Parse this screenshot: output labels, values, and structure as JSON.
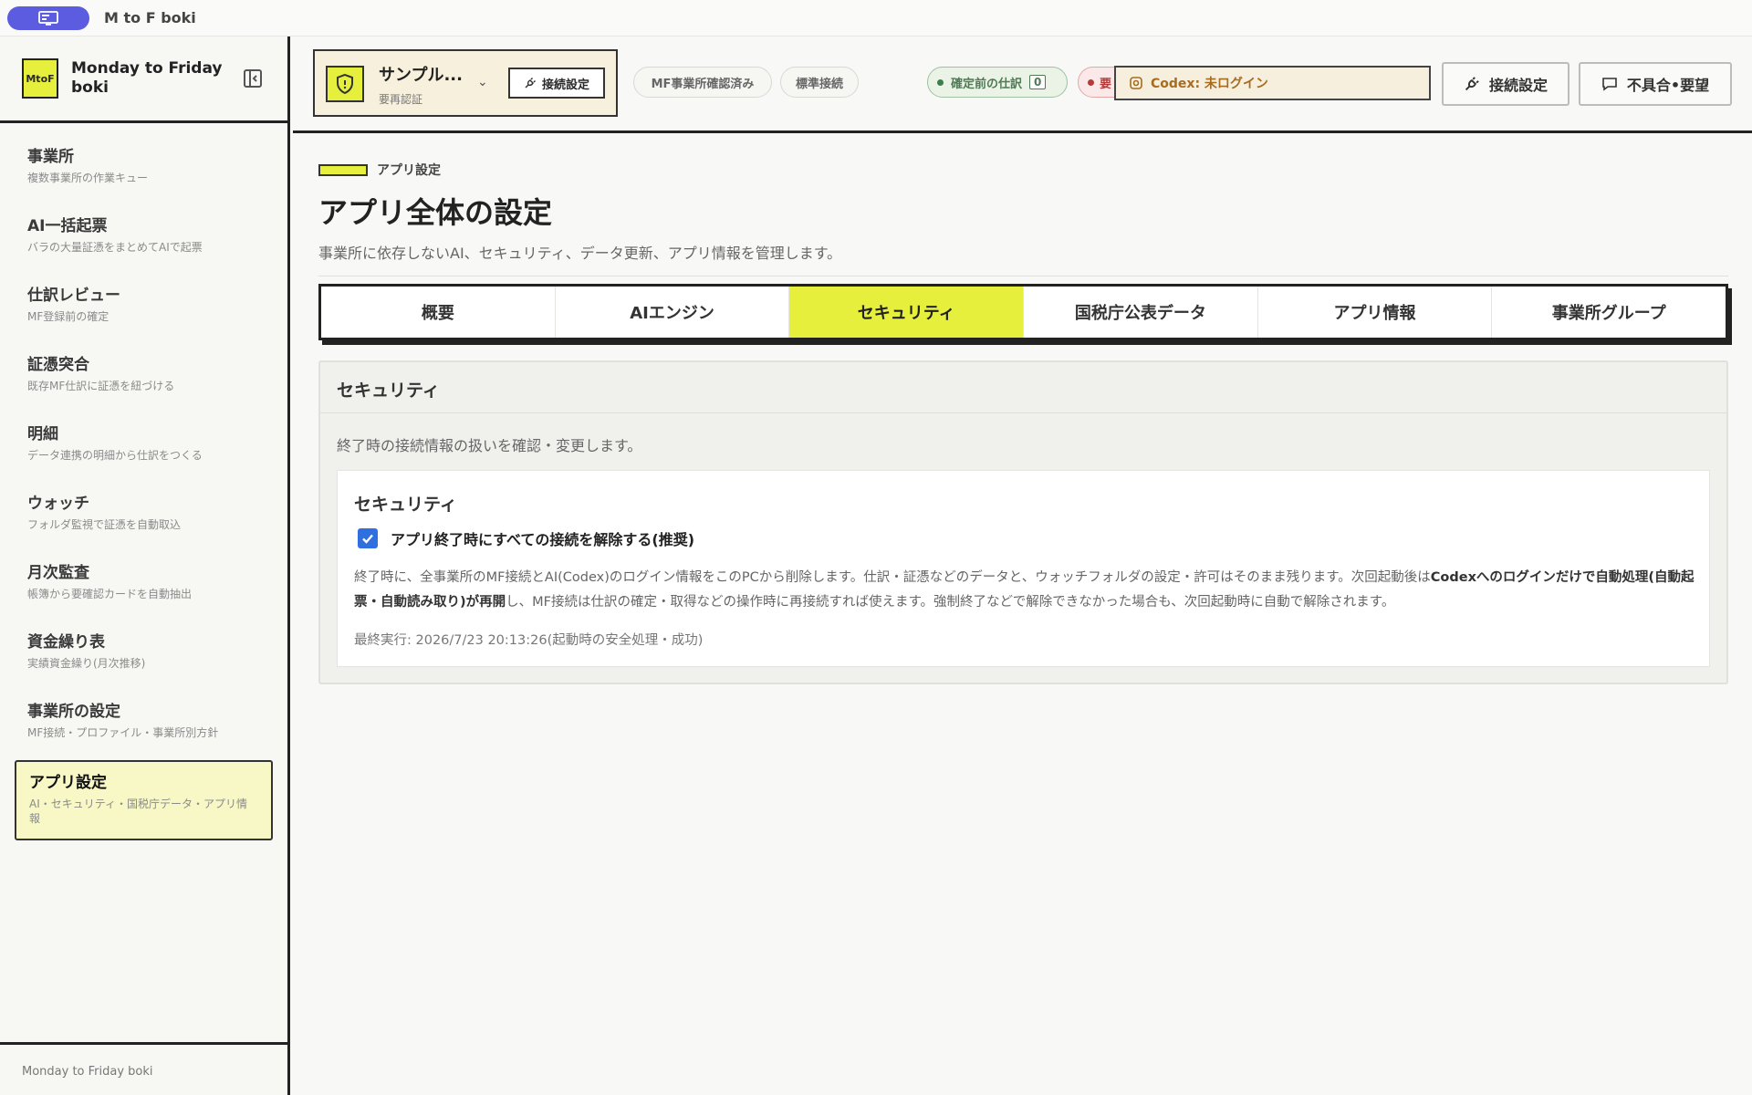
{
  "window": {
    "title": "M to F boki",
    "app_icon": "monitor-icon"
  },
  "sidebar": {
    "logo_text": "MtoF",
    "brand": "Monday to Friday boki",
    "items": [
      {
        "label": "事業所",
        "sub": "複数事業所の作業キュー"
      },
      {
        "label": "AI一括起票",
        "sub": "バラの大量証憑をまとめてAIで起票"
      },
      {
        "label": "仕訳レビュー",
        "sub": "MF登録前の確定"
      },
      {
        "label": "証憑突合",
        "sub": "既存MF仕訳に証憑を紐づける"
      },
      {
        "label": "明細",
        "sub": "データ連携の明細から仕訳をつくる"
      },
      {
        "label": "ウォッチ",
        "sub": "フォルダ監視で証憑を自動取込"
      },
      {
        "label": "月次監査",
        "sub": "帳簿から要確認カードを自動抽出"
      },
      {
        "label": "資金繰り表",
        "sub": "実績資金繰り(月次推移)"
      },
      {
        "label": "事業所の設定",
        "sub": "MF接続・プロファイル・事業所別方針"
      },
      {
        "label": "アプリ設定",
        "sub": "AI・セキュリティ・国税庁データ・アプリ情報"
      }
    ],
    "footer": "Monday to Friday boki"
  },
  "topbar": {
    "office_name": "サンプル...",
    "office_sub": "要再認証",
    "office_connect": "接続設定",
    "chip_confirmed": "MF事業所確認済み",
    "chip_standard": "標準接続",
    "pending_label": "確定前の仕訳",
    "pending_count": "0",
    "warn_label": "要",
    "codex_label": "Codex: 未ログイン",
    "connect_button": "接続設定",
    "feedback_button": "不具合•要望"
  },
  "main": {
    "eyebrow": "アプリ設定",
    "title": "アプリ全体の設定",
    "description": "事業所に依存しないAI、セキュリティ、データ更新、アプリ情報を管理します。",
    "tabs": [
      {
        "label": "概要"
      },
      {
        "label": "AIエンジン"
      },
      {
        "label": "セキュリティ"
      },
      {
        "label": "国税庁公表データ"
      },
      {
        "label": "アプリ情報"
      },
      {
        "label": "事業所グループ"
      }
    ],
    "active_tab": "セキュリティ",
    "panel": {
      "title": "セキュリティ",
      "description": "終了時の接続情報の扱いを確認・変更します。",
      "card_title": "セキュリティ",
      "checkbox_label": "アプリ終了時にすべての接続を解除する(推奨)",
      "checkbox_checked": true,
      "explain_1": "終了時に、全事業所のMF接続とAI(Codex)のログイン情報をこのPCから削除します。仕訳・証憑などのデータと、ウォッチフォルダの設定・許可はそのまま残ります。次回起動後は",
      "explain_bold": "Codexへのログインだけで自動処理(自動起票・自動読み取り)が再開",
      "explain_2": "し、MF接続は仕訳の確定・取得などの操作時に再接続すれば使えます。強制終了などで解除できなかった場合も、次回起動時に自動で解除されます。",
      "last_run": "最終実行: 2026/7/23 20:13:26(起動時の安全処理・成功)"
    }
  },
  "colors": {
    "accent": "#e6f03c",
    "brand_pill": "#5b5ce0",
    "checkbox": "#2f6fe0",
    "ok": "#3c7f48",
    "warn": "#b53b3b",
    "codex": "#a66c1f"
  }
}
